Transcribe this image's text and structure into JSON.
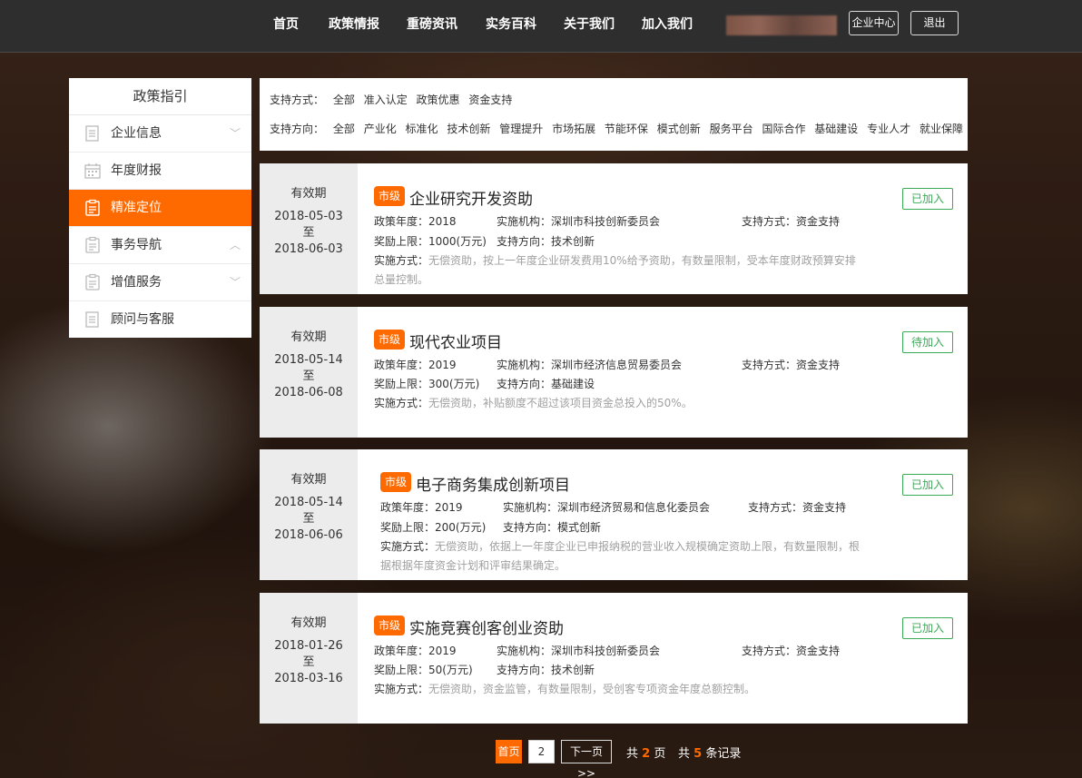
{
  "nav": {
    "items": [
      "首页",
      "政策情报",
      "重磅资讯",
      "实务百科",
      "关于我们",
      "加入我们"
    ],
    "enterprise_center": "企业中心",
    "logout": "退出"
  },
  "sidebar": {
    "title": "政策指引",
    "items": [
      {
        "label": "企业信息",
        "icon": "document-list-icon",
        "arrow": "down"
      },
      {
        "label": "年度财报",
        "icon": "calendar-icon",
        "arrow": ""
      },
      {
        "label": "精准定位",
        "icon": "clipboard-icon",
        "arrow": "",
        "active": true
      },
      {
        "label": "事务导航",
        "icon": "clipboard-icon",
        "arrow": "up"
      },
      {
        "label": "增值服务",
        "icon": "clipboard-icon",
        "arrow": "down"
      },
      {
        "label": "顾问与客服",
        "icon": "document-list-icon",
        "arrow": ""
      }
    ]
  },
  "filters": {
    "support_mode_label": "支持方式：",
    "support_mode_options": [
      "全部",
      "准入认定",
      "政策优惠",
      "资金支持"
    ],
    "support_direction_label": "支持方向：",
    "support_direction_options": [
      "全部",
      "产业化",
      "标准化",
      "技术创新",
      "管理提升",
      "市场拓展",
      "节能环保",
      "模式创新",
      "服务平台",
      "国际合作",
      "基础建设",
      "专业人才",
      "就业保障"
    ]
  },
  "validity_label": "有效期",
  "date_separator": "至",
  "policies": [
    {
      "start": "2018-05-03",
      "end": "2018-06-03",
      "level": "市级",
      "title": "企业研究开发资助",
      "year_label": "政策年度：2018",
      "agency_label": "实施机构：深圳市科技创新委员会",
      "mode_label": "支持方式：资金支持",
      "limit_label": "奖励上限：1000(万元)",
      "direction_label": "支持方向：技术创新",
      "method_label": "实施方式：",
      "method_text": "无偿资助，按上一年度企业研发费用10%给予资助，有数量限制，受本年度财政预算安排总量控制。",
      "status": "已加入"
    },
    {
      "start": "2018-05-14",
      "end": "2018-06-08",
      "level": "市级",
      "title": "现代农业项目",
      "year_label": "政策年度：2019",
      "agency_label": "实施机构：深圳市经济信息贸易委员会",
      "mode_label": "支持方式：资金支持",
      "limit_label": "奖励上限：300(万元)",
      "direction_label": "支持方向：基础建设",
      "method_label": "实施方式：",
      "method_text": "无偿资助，补贴额度不超过该项目资金总投入的50%。",
      "status": "待加入"
    },
    {
      "start": "2018-05-14",
      "end": "2018-06-06",
      "level": "市级",
      "title": "电子商务集成创新项目",
      "year_label": "政策年度：2019",
      "agency_label": "实施机构：深圳市经济贸易和信息化委员会",
      "mode_label": "支持方式：资金支持",
      "limit_label": "奖励上限：200(万元)",
      "direction_label": "支持方向：模式创新",
      "method_label": "实施方式：",
      "method_text": "无偿资助，依据上一年度企业已申报纳税的营业收入规模确定资助上限，有数量限制，根据根据年度资金计划和评审结果确定。",
      "status": "已加入"
    },
    {
      "start": "2018-01-26",
      "end": "2018-03-16",
      "level": "市级",
      "title": "实施竞赛创客创业资助",
      "year_label": "政策年度：2019",
      "agency_label": "实施机构：深圳市科技创新委员会",
      "mode_label": "支持方式：资金支持",
      "limit_label": "奖励上限：50(万元)",
      "direction_label": "支持方向：技术创新",
      "method_label": "实施方式：",
      "method_text": "无偿资助，资金监管，有数量限制，受创客专项资金年度总额控制。",
      "status": "已加入"
    }
  ],
  "pagination": {
    "first": "首页",
    "page2": "2",
    "next": "下一页>>",
    "total_pages_prefix": "共",
    "total_pages": "2",
    "total_pages_suffix": "页",
    "total_records_prefix": "共",
    "total_records": "5",
    "total_records_suffix": "条记录"
  },
  "colors": {
    "accent": "#ff6a00",
    "status_green": "#3aaa57",
    "nav_bg": "#2e2e2e"
  }
}
